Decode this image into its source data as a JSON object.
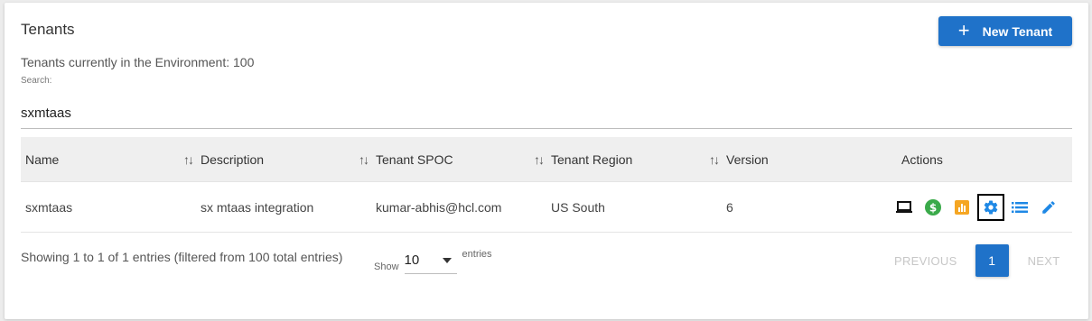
{
  "header": {
    "title": "Tenants",
    "new_button_label": "New Tenant",
    "env_text": "Tenants currently in the Environment: 100"
  },
  "search": {
    "label": "Search:",
    "value": "sxmtaas"
  },
  "table": {
    "columns": [
      "Name",
      "Description",
      "Tenant SPOC",
      "Tenant Region",
      "Version",
      "Actions"
    ],
    "rows": [
      {
        "name": "sxmtaas",
        "description": "sx mtaas integration",
        "spoc": "kumar-abhis@hcl.com",
        "region": "US South",
        "version": "6"
      }
    ],
    "action_icons": [
      "laptop-icon",
      "dollar-icon",
      "bar-chart-icon",
      "gear-icon",
      "list-icon",
      "pencil-icon"
    ]
  },
  "footer": {
    "info": "Showing 1 to 1 of 1 entries (filtered from 100 total entries)",
    "show_label": "Show",
    "page_size": "10",
    "entries_label": "entries"
  },
  "pagination": {
    "previous": "PREVIOUS",
    "current": "1",
    "next": "NEXT"
  },
  "colors": {
    "primary": "#1f72c9",
    "green": "#3aaa4a",
    "orange": "#f5a623",
    "icon_blue": "#1e88e5"
  }
}
